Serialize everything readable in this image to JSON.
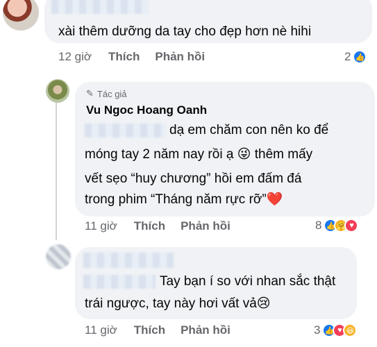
{
  "comments": [
    {
      "text": "xài thêm dưỡng da tay cho đẹp hơn nè hihi",
      "time": "12 giờ",
      "like_label": "Thích",
      "reply_label": "Phản hồi",
      "reaction_count": "2",
      "reactions": [
        "like-icon"
      ]
    },
    {
      "author_tag": "Tác giả",
      "author_name": "Vu Ngoc Hoang Oanh",
      "lines": [
        "dạ em chăm con nên ko để",
        "móng tay 2 năm nay rồi ạ 😜 thêm mấy",
        "vết sẹo “huy chương” hồi em đấm đá",
        "trong phim “Tháng năm rực rỡ”❤️"
      ],
      "time": "11 giờ",
      "like_label": "Thích",
      "reply_label": "Phản hồi",
      "reaction_count": "8",
      "reactions": [
        "like-icon",
        "care-icon",
        "love-icon"
      ]
    },
    {
      "lines": [
        "Tay bạn í so với nhan sắc thật",
        "trái ngược, tay này hơi vất vả😢"
      ],
      "time": "11 giờ",
      "like_label": "Thích",
      "reply_label": "Phản hồi",
      "reaction_count": "3",
      "reactions": [
        "like-icon",
        "love-icon",
        "haha-icon"
      ]
    }
  ],
  "colors": {
    "bubble": "#f0f2f5",
    "meta": "#65676b",
    "like": "#1877f2",
    "love": "#f33e58",
    "haha": "#f7b125"
  }
}
